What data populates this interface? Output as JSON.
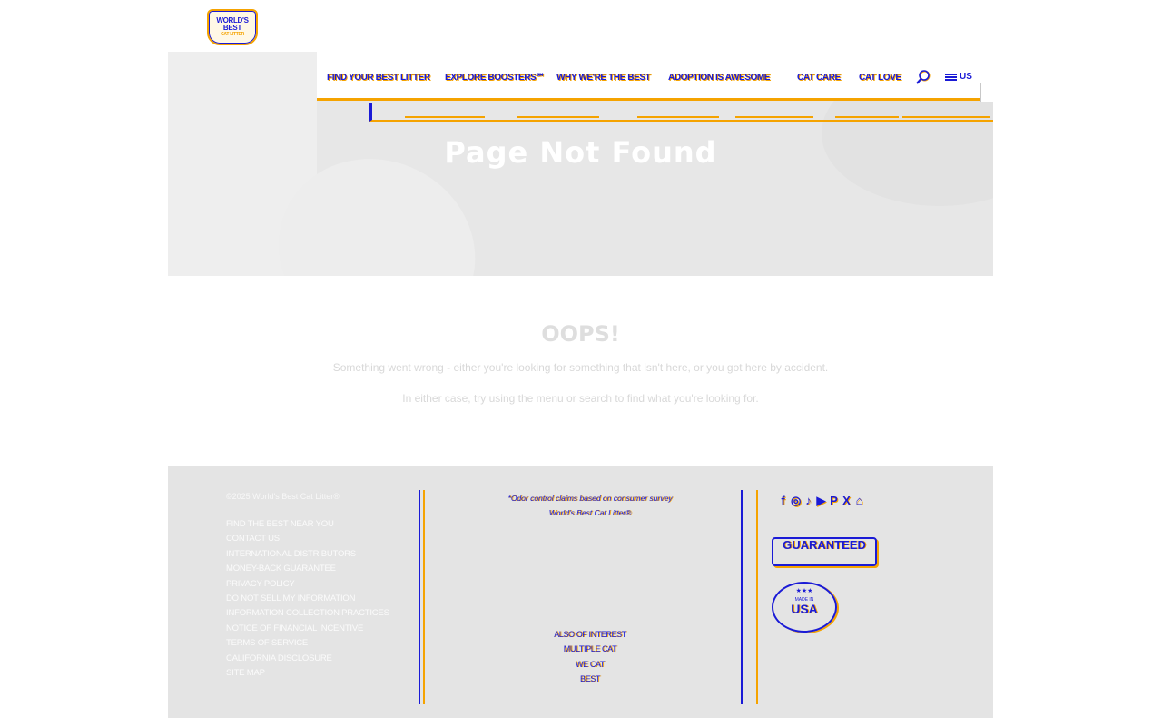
{
  "header": {
    "logo": {
      "line1": "WORLD'S",
      "line2": "BEST",
      "line3": "CAT LITTER"
    },
    "nav": [
      "FIND YOUR BEST LITTER",
      "EXPLORE BOOSTERS℠",
      "WHY WE'RE THE BEST",
      "ADOPTION IS AWESOME",
      "CAT CARE",
      "CAT LOVE"
    ],
    "locale": "US"
  },
  "hero": {
    "title": "Page Not Found"
  },
  "main": {
    "heading": "OOPS!",
    "line1": "Something went wrong - either you're looking for something that isn't here, or you got here by accident.",
    "line2": "In either case, try using the menu or search to find what you're looking for."
  },
  "footer": {
    "copyright": "©2025 World's Best Cat Litter®",
    "links": [
      "FIND THE BEST NEAR YOU",
      "CONTACT US",
      "INTERNATIONAL DISTRIBUTORS",
      "MONEY-BACK GUARANTEE",
      "PRIVACY POLICY",
      "DO NOT SELL MY INFORMATION",
      "INFORMATION COLLECTION PRACTICES",
      "NOTICE OF FINANCIAL INCENTIVE",
      "TERMS OF SERVICE",
      "CALIFORNIA DISCLOSURE",
      "SITE MAP"
    ],
    "disclaimer1": "*Odor control claims based on consumer survey",
    "disclaimer2": "World's Best Cat Litter®",
    "disclaimer3": "",
    "disclaimer4": "",
    "also_links": [
      "ALSO OF INTEREST",
      "MULTIPLE CAT",
      "WE CAT",
      "BEST"
    ],
    "social_icons": [
      "facebook-icon",
      "instagram-icon",
      "tiktok-icon",
      "youtube-icon",
      "pinterest-icon",
      "x-icon",
      "home-icon"
    ],
    "badge_guaranteed": {
      "top": "",
      "main": "GUARANTEED",
      "bottom": ""
    },
    "badge_usa": {
      "made": "MADE IN",
      "country": "USA"
    }
  },
  "colors": {
    "accent": "#f5a300",
    "brand": "#1a1ad6",
    "hero_bg": "#e7e7e7",
    "footer_bg": "#e4e4e4"
  }
}
